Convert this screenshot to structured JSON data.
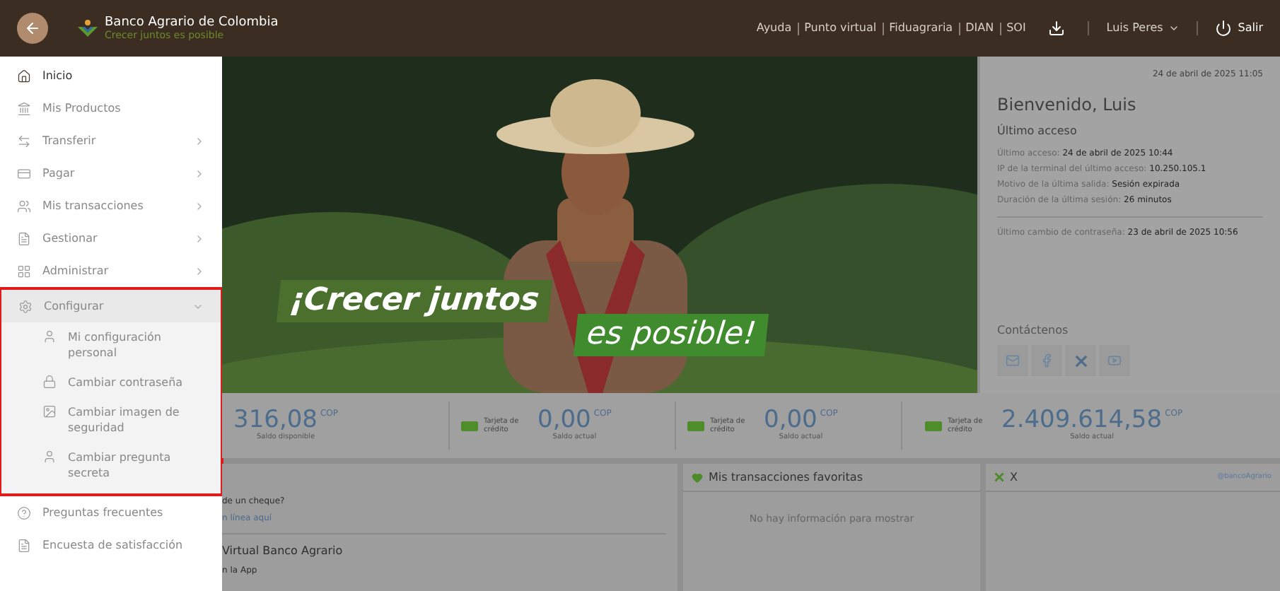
{
  "header": {
    "brand": "Banco Agrario de Colombia",
    "slogan": "Crecer juntos es posible",
    "links": [
      "Ayuda",
      "Punto virtual",
      "Fiduagraria",
      "DIAN",
      "SOI"
    ],
    "user": "Luis Peres",
    "logout": "Salir"
  },
  "sidebar": {
    "items": [
      {
        "label": "Inicio",
        "has_submenu": false,
        "selected": true
      },
      {
        "label": "Mis Productos",
        "has_submenu": false,
        "selected": false
      },
      {
        "label": "Transferir",
        "has_submenu": true,
        "selected": false
      },
      {
        "label": "Pagar",
        "has_submenu": true,
        "selected": false
      },
      {
        "label": "Mis transacciones",
        "has_submenu": true,
        "selected": false
      },
      {
        "label": "Gestionar",
        "has_submenu": true,
        "selected": false
      },
      {
        "label": "Administrar",
        "has_submenu": true,
        "selected": false
      },
      {
        "label": "Configurar",
        "has_submenu": true,
        "selected": false,
        "expanded": true,
        "highlighted": true,
        "children": [
          {
            "label": "Mi configuración personal"
          },
          {
            "label": "Cambiar contraseña"
          },
          {
            "label": "Cambiar imagen de seguridad"
          },
          {
            "label": "Cambiar pregunta secreta"
          }
        ]
      },
      {
        "label": "Preguntas frecuentes",
        "has_submenu": false,
        "selected": false
      },
      {
        "label": "Encuesta de satisfacción",
        "has_submenu": false,
        "selected": false
      }
    ]
  },
  "banner": {
    "kind": "picture",
    "headline": "¡Crecer juntos",
    "tagline": "es posible!"
  },
  "welcome": {
    "date": "24 de abril de 2025 11:05",
    "greeting": "Bienvenido, Luis",
    "section": "Último acceso",
    "rows": [
      {
        "label": "Último acceso:",
        "value": "24 de abril de 2025 10:44"
      },
      {
        "label": "IP de la terminal del último acceso:",
        "value": "10.250.105.1"
      },
      {
        "label": "Motivo de la última salida:",
        "value": "Sesión expirada"
      },
      {
        "label": "Duración de la última sesión:",
        "value": "26 minutos"
      }
    ],
    "password_change": {
      "label": "Último cambio de contraseña:",
      "value": "23 de abril de 2025 10:56"
    },
    "contact_title": "Contáctenos"
  },
  "balances": [
    {
      "kind": "account",
      "amount": "316,08",
      "currency": "COP",
      "caption": "Saldo disponible"
    },
    {
      "kind": "card",
      "product": "Tarjeta de crédito",
      "amount": "0,00",
      "currency": "COP",
      "caption": "Saldo actual"
    },
    {
      "kind": "card",
      "product": "Tarjeta de crédito",
      "amount": "0,00",
      "currency": "COP",
      "caption": "Saldo actual"
    },
    {
      "kind": "card",
      "product": "Tarjeta de crédito",
      "amount": "2.409.614,58",
      "currency": "COP",
      "caption": "Saldo actual"
    }
  ],
  "info_card": {
    "question": "de un cheque?",
    "link": "n línea aquí",
    "title": "Virtual Banco Agrario",
    "subtitle": "n la App"
  },
  "favorites": {
    "title": "Mis transacciones favoritas",
    "empty": "No hay información para mostrar"
  },
  "social": {
    "title": "X",
    "handle": "@bancoAgrario"
  }
}
